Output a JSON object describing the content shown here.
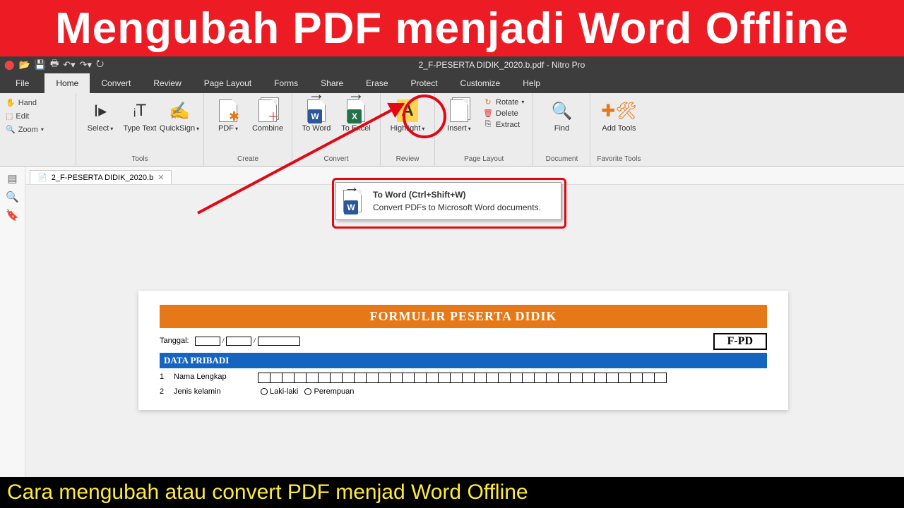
{
  "banner": {
    "top": "Mengubah PDF menjadi Word Offline",
    "bottom": "Cara mengubah atau convert PDF menjad Word Offline"
  },
  "titlebar": {
    "doc": "2_F-PESERTA DIDIK_2020.b.pdf - Nitro Pro"
  },
  "menu": {
    "file": "File",
    "items": [
      "Home",
      "Convert",
      "Review",
      "Page Layout",
      "Forms",
      "Share",
      "Erase",
      "Protect",
      "Customize",
      "Help"
    ]
  },
  "left_tools": {
    "hand": "Hand",
    "edit": "Edit",
    "zoom": "Zoom"
  },
  "ribbon": {
    "tools": {
      "label": "Tools",
      "select": "Select",
      "typetext": "Type Text",
      "quicksign": "QuickSign"
    },
    "create": {
      "label": "Create",
      "pdf": "PDF",
      "combine": "Combine"
    },
    "convert": {
      "label": "Convert",
      "toword": "To Word",
      "toexcel": "To Excel"
    },
    "review": {
      "label": "Review",
      "highlight": "Highlight"
    },
    "pagelayout": {
      "label": "Page Layout",
      "insert": "Insert",
      "rotate": "Rotate",
      "delete": "Delete",
      "extract": "Extract"
    },
    "document": {
      "label": "Document",
      "find": "Find"
    },
    "favorite": {
      "label": "Favorite Tools",
      "add": "Add Tools"
    }
  },
  "tab": {
    "name": "2_F-PESERTA DIDIK_2020.b"
  },
  "tooltip": {
    "title": "To Word (Ctrl+Shift+W)",
    "desc": "Convert PDFs to Microsoft Word documents."
  },
  "form": {
    "title": "FORMULIR PESERTA DIDIK",
    "code": "F-PD",
    "tanggal": "Tanggal:",
    "section": "DATA PRIBADI",
    "f1_num": "1",
    "f1": "Nama Lengkap",
    "f2_num": "2",
    "f2": "Jenis kelamin",
    "f2_opt1": "Laki-laki",
    "f2_opt2": "Perempuan"
  }
}
